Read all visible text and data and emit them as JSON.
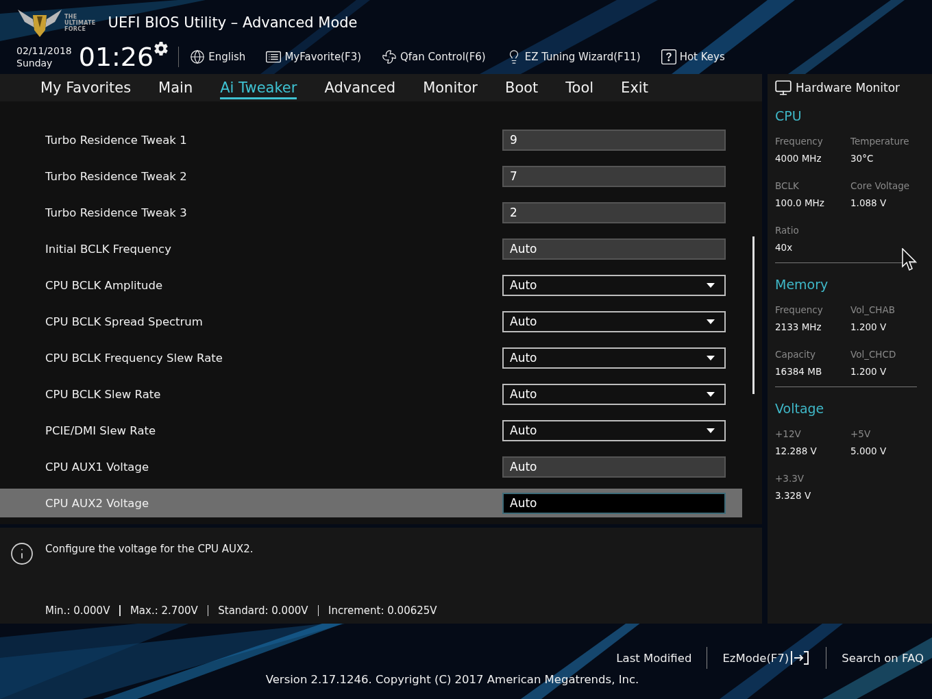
{
  "header": {
    "logo_text": [
      "THE",
      "ULTIMATE",
      "FORCE"
    ],
    "title": "UEFI BIOS Utility – Advanced Mode",
    "date": "02/11/2018",
    "day": "Sunday",
    "time": "01:26",
    "tools": [
      {
        "kind": "language",
        "label": "English"
      },
      {
        "kind": "favorite",
        "label": "MyFavorite(F3)"
      },
      {
        "kind": "fan",
        "label": "Qfan Control(F6)"
      },
      {
        "kind": "wizard",
        "label": "EZ Tuning Wizard(F11)"
      },
      {
        "kind": "hotkeys",
        "label": "Hot Keys"
      }
    ]
  },
  "tabs": [
    {
      "label": "My Favorites",
      "selected": false
    },
    {
      "label": "Main",
      "selected": false
    },
    {
      "label": "Ai Tweaker",
      "selected": true
    },
    {
      "label": "Advanced",
      "selected": false
    },
    {
      "label": "Monitor",
      "selected": false
    },
    {
      "label": "Boot",
      "selected": false
    },
    {
      "label": "Tool",
      "selected": false
    },
    {
      "label": "Exit",
      "selected": false
    }
  ],
  "settings": [
    {
      "label": "Turbo Residence Tweak 1",
      "value": "9",
      "kind": "input",
      "selected": false
    },
    {
      "label": "Turbo Residence Tweak 2",
      "value": "7",
      "kind": "input",
      "selected": false
    },
    {
      "label": "Turbo Residence Tweak 3",
      "value": "2",
      "kind": "input",
      "selected": false
    },
    {
      "label": "Initial BCLK Frequency",
      "value": "Auto",
      "kind": "input",
      "selected": false
    },
    {
      "label": "CPU BCLK Amplitude",
      "value": "Auto",
      "kind": "dropdown",
      "selected": false
    },
    {
      "label": "CPU BCLK Spread Spectrum",
      "value": "Auto",
      "kind": "dropdown",
      "selected": false
    },
    {
      "label": "CPU BCLK Frequency Slew Rate",
      "value": "Auto",
      "kind": "dropdown",
      "selected": false
    },
    {
      "label": "CPU BCLK Slew Rate",
      "value": "Auto",
      "kind": "dropdown",
      "selected": false
    },
    {
      "label": "PCIE/DMI Slew Rate",
      "value": "Auto",
      "kind": "dropdown",
      "selected": false
    },
    {
      "label": "CPU AUX1 Voltage",
      "value": "Auto",
      "kind": "input",
      "selected": false
    },
    {
      "label": "CPU AUX2 Voltage",
      "value": "Auto",
      "kind": "input",
      "selected": true
    }
  ],
  "help": {
    "text": "Configure the voltage for the CPU AUX2.",
    "limits": [
      "Min.: 0.000V",
      "Max.: 2.700V",
      "Standard: 0.000V",
      "Increment: 0.00625V"
    ]
  },
  "hardware_monitor": {
    "title": "Hardware Monitor",
    "sections": [
      {
        "title": "CPU",
        "items": [
          {
            "label": "Frequency",
            "value": "4000 MHz"
          },
          {
            "label": "Temperature",
            "value": "30°C"
          },
          {
            "label": "BCLK",
            "value": "100.0 MHz"
          },
          {
            "label": "Core Voltage",
            "value": "1.088 V"
          },
          {
            "label": "Ratio",
            "value": "40x"
          }
        ]
      },
      {
        "title": "Memory",
        "items": [
          {
            "label": "Frequency",
            "value": "2133 MHz"
          },
          {
            "label": "Vol_CHAB",
            "value": "1.200 V"
          },
          {
            "label": "Capacity",
            "value": "16384 MB"
          },
          {
            "label": "Vol_CHCD",
            "value": "1.200 V"
          }
        ]
      },
      {
        "title": "Voltage",
        "items": [
          {
            "label": "+12V",
            "value": "12.288 V"
          },
          {
            "label": "+5V",
            "value": "5.000 V"
          },
          {
            "label": "+3.3V",
            "value": "3.328 V"
          }
        ]
      }
    ]
  },
  "footer": {
    "links": [
      {
        "kind": "plain",
        "label": "Last Modified"
      },
      {
        "kind": "ezmode",
        "label": "EzMode(F7)"
      },
      {
        "kind": "plain",
        "label": "Search on FAQ"
      }
    ],
    "version": "Version 2.17.1246. Copyright (C) 2017 American Megatrends, Inc."
  }
}
